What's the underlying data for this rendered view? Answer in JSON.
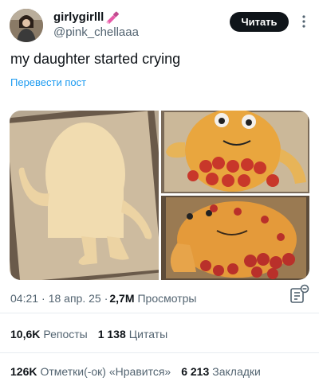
{
  "author": {
    "display_name": "girlygirlll",
    "handle": "@pink_chellaaa"
  },
  "follow_label": "Читать",
  "tweet": {
    "text": "my daughter started crying",
    "translate_label": "Перевести пост"
  },
  "meta": {
    "time": "04:21",
    "separator": "·",
    "date": "18 апр. 25",
    "views_count": "2,7M",
    "views_label": "Просмотры"
  },
  "stats": {
    "reposts_count": "10,6K",
    "reposts_label": "Репосты",
    "quotes_count": "1 138",
    "quotes_label": "Цитаты",
    "likes_count": "126K",
    "likes_label": "Отметки(-ок) «Нравится»",
    "bookmarks_count": "6 213",
    "bookmarks_label": "Закладки"
  },
  "icons": {
    "more": "more-vertical-icon",
    "analytics": "analytics-icon",
    "name_emoji": "nail-polish-emoji-icon"
  },
  "colors": {
    "text": "#0f1419",
    "secondary": "#536471",
    "link": "#1d9bf0",
    "button_bg": "#0f1419"
  }
}
